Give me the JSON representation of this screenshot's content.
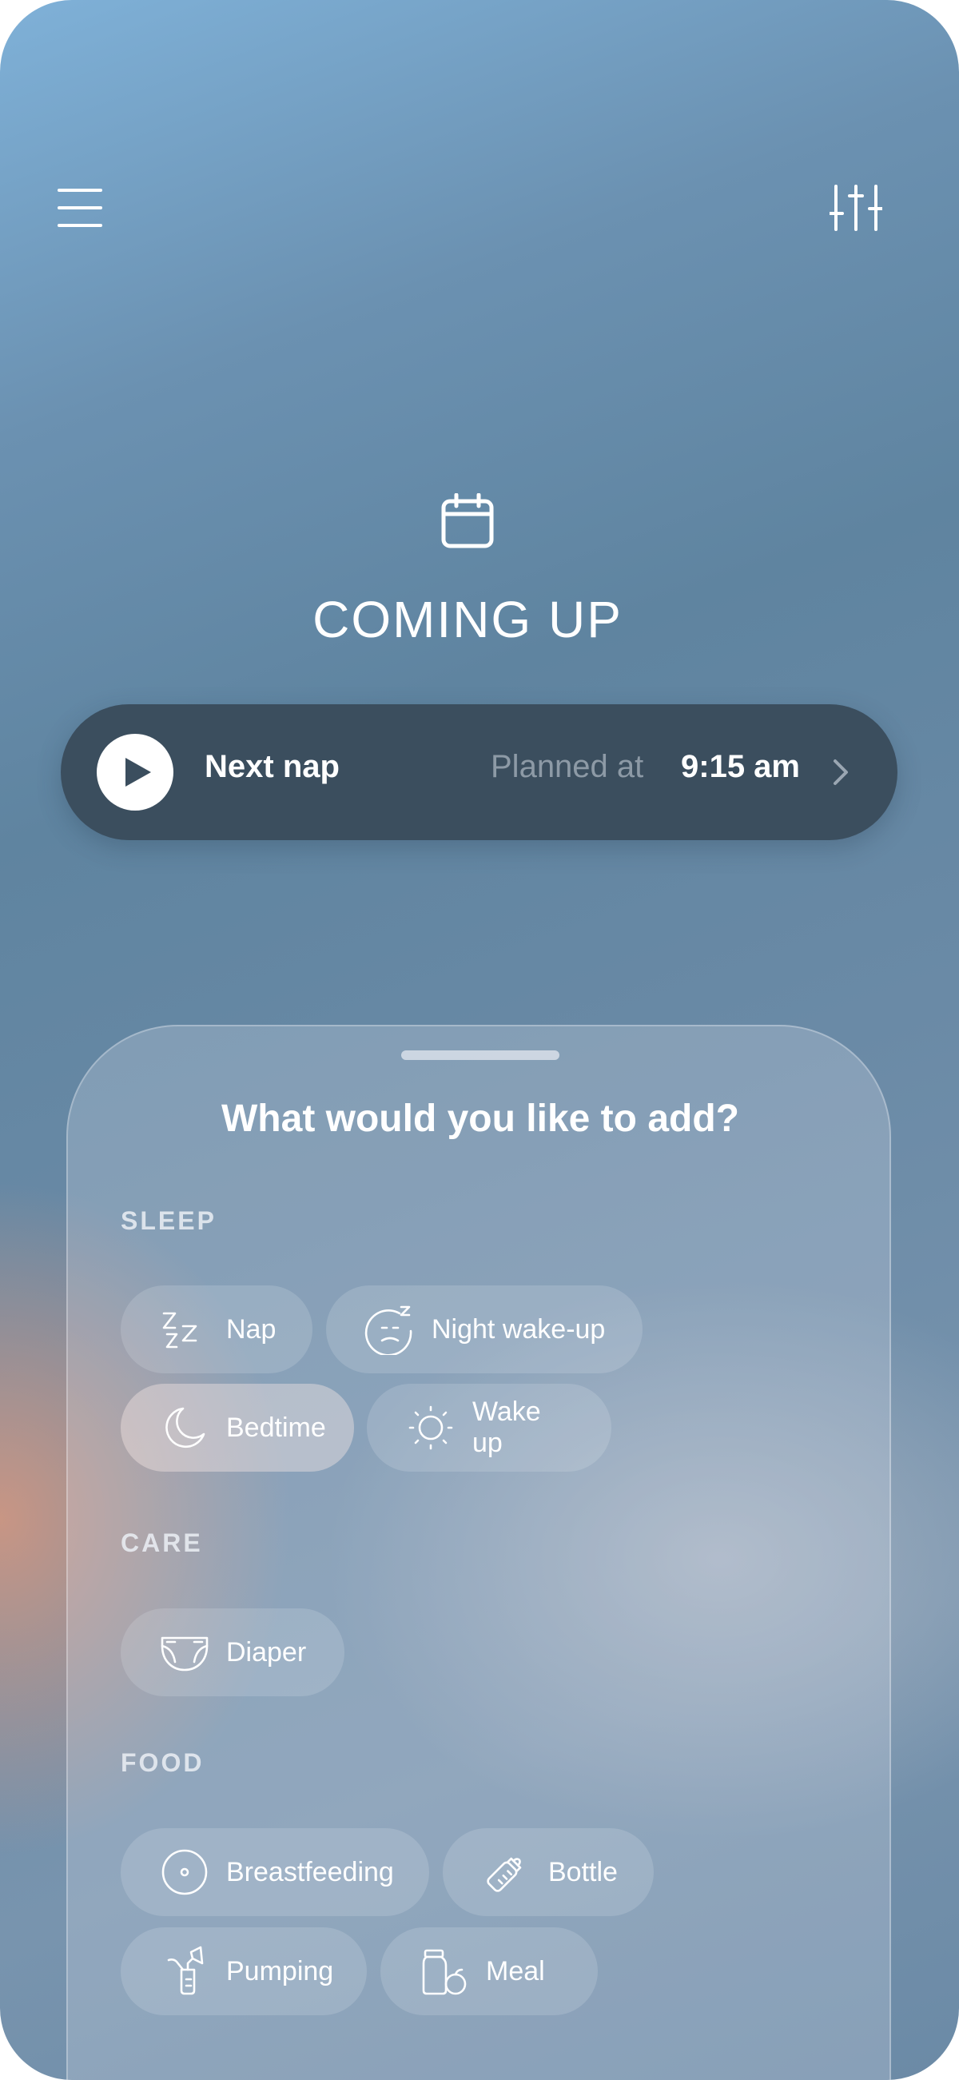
{
  "header": {
    "menu_icon": "hamburger-menu-icon",
    "filter_icon": "sliders-icon"
  },
  "coming_up": {
    "icon": "calendar-icon",
    "title": "COMING UP",
    "card": {
      "label": "Next nap",
      "planned_prefix": "Planned at",
      "time": "9:15 am",
      "play_icon": "play-icon",
      "chevron_icon": "chevron-right-icon"
    }
  },
  "add_sheet": {
    "title": "What would you like to add?",
    "sections": {
      "sleep": {
        "label": "SLEEP",
        "items": [
          {
            "label": "Nap",
            "icon": "zzz-icon"
          },
          {
            "label": "Night wake-up",
            "icon": "sleepy-face-icon"
          },
          {
            "label": "Bedtime",
            "icon": "moon-icon",
            "active": true
          },
          {
            "label": "Wake up",
            "icon": "sun-icon"
          }
        ]
      },
      "care": {
        "label": "CARE",
        "items": [
          {
            "label": "Diaper",
            "icon": "diaper-icon"
          }
        ]
      },
      "food": {
        "label": "FOOD",
        "items": [
          {
            "label": "Breastfeeding",
            "icon": "breast-icon"
          },
          {
            "label": "Bottle",
            "icon": "bottle-icon"
          },
          {
            "label": "Pumping",
            "icon": "breast-pump-icon"
          },
          {
            "label": "Meal",
            "icon": "jar-apple-icon"
          }
        ]
      }
    }
  },
  "colors": {
    "card_background": "#3b4e5e",
    "planned_text": "#8d9aa6",
    "text_primary": "#ffffff"
  }
}
